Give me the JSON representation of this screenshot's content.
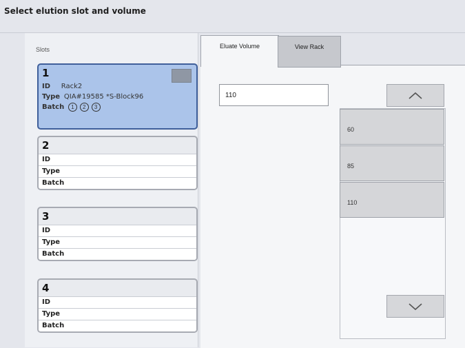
{
  "header": {
    "title": "Select elution slot and volume"
  },
  "slots_panel": {
    "label": "Slots",
    "slots": [
      {
        "number": "1",
        "id_label": "ID",
        "id_value": "Rack2",
        "type_label": "Type",
        "type_value": "QIA#19585 *S-Block96",
        "batch_label": "Batch",
        "batches": [
          "1",
          "2",
          "3"
        ]
      },
      {
        "number": "2",
        "id_label": "ID",
        "type_label": "Type",
        "batch_label": "Batch"
      },
      {
        "number": "3",
        "id_label": "ID",
        "type_label": "Type",
        "batch_label": "Batch"
      },
      {
        "number": "4",
        "id_label": "ID",
        "type_label": "Type",
        "batch_label": "Batch"
      }
    ]
  },
  "tabs": [
    {
      "label": "Eluate Volume",
      "active": true
    },
    {
      "label": "View Rack",
      "active": false
    }
  ],
  "eluate_volume": {
    "value": "110",
    "options": [
      "60",
      "85",
      "110"
    ]
  },
  "colors": {
    "selected_slot_bg": "#abc4ea",
    "selected_slot_border": "#3f5f9a",
    "panel_bg": "#e4e6ec"
  }
}
